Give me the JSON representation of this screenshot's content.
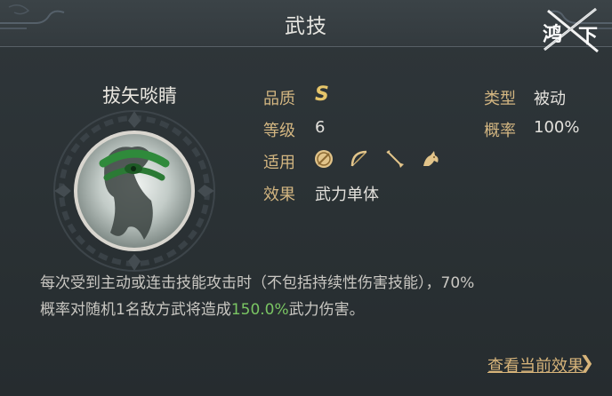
{
  "header": {
    "title": "武技",
    "logo_text": "鸿图之下"
  },
  "skill": {
    "name": "拔矢啖睛",
    "quality_label": "品质",
    "quality_value": "S",
    "level_label": "等级",
    "level_value": "6",
    "applies_label": "适用",
    "applies_icons": [
      "shield-icon",
      "bow-icon",
      "spear-icon",
      "horse-icon"
    ],
    "effect_label": "效果",
    "effect_value": "武力单体",
    "type_label": "类型",
    "type_value": "被动",
    "rate_label": "概率",
    "rate_value": "100%"
  },
  "description": {
    "line1": "每次受到主动或连击技能攻击时（不包括持续性伤害技能），70%",
    "line2_pre": "概率对随机1名敌方武将造成",
    "line2_highlight": "150.0%",
    "line2_post": "武力伤害。"
  },
  "footer": {
    "link_label": "查看当前效果",
    "link_arrow": "❯"
  },
  "colors": {
    "label": "#d3b681",
    "value": "#e3e1dc",
    "highlight": "#7ac563",
    "link": "#d7b47a"
  }
}
